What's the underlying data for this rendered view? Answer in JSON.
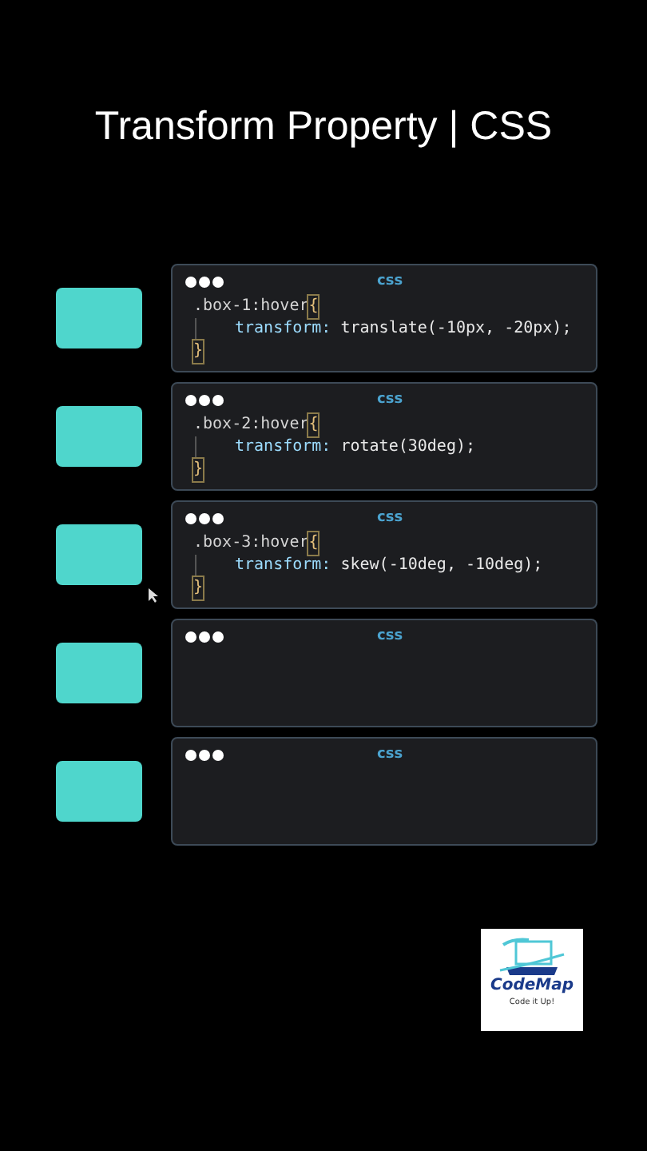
{
  "title": "Transform Property | CSS",
  "rows": [
    {
      "lang": "css",
      "code": {
        "selector": ".box-1:hover",
        "open": "{",
        "property": "transform:",
        "value": "translate(-10px, -20px);",
        "close": "}"
      }
    },
    {
      "lang": "css",
      "code": {
        "selector": ".box-2:hover",
        "open": "{",
        "property": "transform:",
        "value": "rotate(30deg);",
        "close": "}"
      }
    },
    {
      "lang": "css",
      "code": {
        "selector": ".box-3:hover",
        "open": "{",
        "property": "transform:",
        "value": "skew(-10deg, -10deg);",
        "close": "}"
      },
      "pointer": true
    },
    {
      "lang": "css"
    },
    {
      "lang": "css"
    }
  ],
  "logo": {
    "name": "CodeMap",
    "tagline": "Code it Up!"
  }
}
